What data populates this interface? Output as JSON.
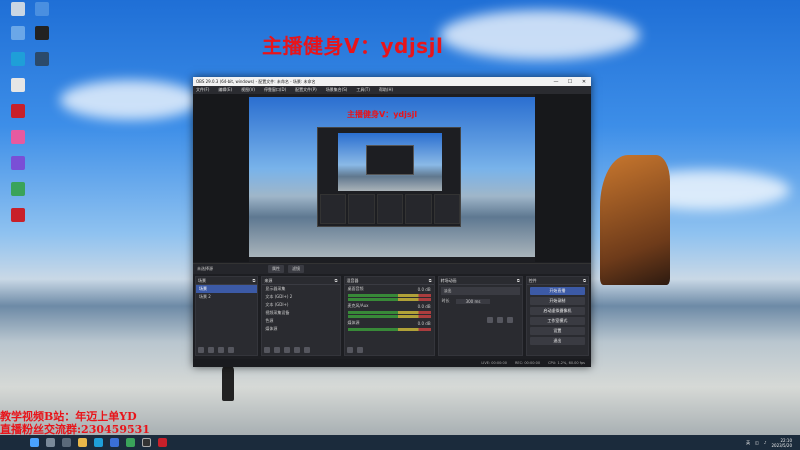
{
  "overlay": {
    "top_text": "主播健身V：ydjsjl",
    "bottom_line1": "教学视频B站：年迈上单YD",
    "bottom_line2": "直播粉丝交流群:230459531"
  },
  "desktop_icons": [
    {
      "name": "recycle-bin-icon",
      "label": "",
      "color": "#c9d6e3"
    },
    {
      "name": "control-panel-icon",
      "label": "",
      "color": "#4a8fe0"
    },
    {
      "name": "computer-icon",
      "label": "",
      "color": "#6aa7e8"
    },
    {
      "name": "app-icon-dark",
      "label": "",
      "color": "#222222"
    },
    {
      "name": "edge-icon",
      "label": "",
      "color": "#1f9fd8"
    },
    {
      "name": "steam-icon",
      "label": "",
      "color": "#2b4a6b"
    },
    {
      "name": "file-icon",
      "label": "",
      "color": "#e6e6e6"
    },
    {
      "name": "adobe-icon",
      "label": "",
      "color": "#c8202a"
    },
    {
      "name": "pink-app-icon",
      "label": "",
      "color": "#e65aa0"
    },
    {
      "name": "purple-app-icon",
      "label": "",
      "color": "#7a4fd6"
    },
    {
      "name": "green-app-icon",
      "label": "",
      "color": "#3aa35a"
    },
    {
      "name": "red-app-icon",
      "label": "",
      "color": "#c8202a"
    }
  ],
  "obs": {
    "title": "OBS 29.0.3 (64-bit, windows) - 配置文件: 未命名 - 场景: 未命名",
    "window_controls": [
      "—",
      "☐",
      "✕"
    ],
    "menu": [
      "文件(F)",
      "编辑(E)",
      "视图(V)",
      "停靠窗口(D)",
      "配置文件(P)",
      "场景集合(S)",
      "工具(T)",
      "帮助(H)"
    ],
    "preview_title": "主播健身V：ydjsjl",
    "toolbar": {
      "label": "未选择源",
      "buttons": [
        "属性",
        "滤镜"
      ]
    },
    "docks": {
      "scenes": {
        "title": "场景",
        "items": [
          "场景",
          "场景 2"
        ]
      },
      "sources": {
        "title": "来源",
        "items": [
          "显示器采集",
          "文本 (GDI+) 2",
          "文本 (GDI+)",
          "视频采集设备",
          "色源",
          "媒体源"
        ]
      },
      "mixer": {
        "title": "混音器",
        "channels": [
          {
            "name": "桌面音频",
            "level": "0.0 dB"
          },
          {
            "name": "麦克风/Aux",
            "level": "0.0 dB"
          },
          {
            "name": "媒体源",
            "level": "0.0 dB"
          }
        ]
      },
      "transitions": {
        "title": "转场动画",
        "current": "淡出",
        "duration_label": "时长",
        "duration": "300 ms"
      },
      "controls": {
        "title": "控件",
        "buttons": [
          "开始直播",
          "开始录制",
          "启动虚拟摄像机",
          "工作室模式",
          "设置",
          "退出"
        ]
      }
    },
    "status": {
      "live": "LIVE: 00:00:00",
      "rec": "REC: 00:00:00",
      "cpu": "CPU: 1.2%, 60.00 fps"
    }
  },
  "taskbar": {
    "time": "22:10",
    "date": "2023/5/20",
    "lang": "英"
  }
}
